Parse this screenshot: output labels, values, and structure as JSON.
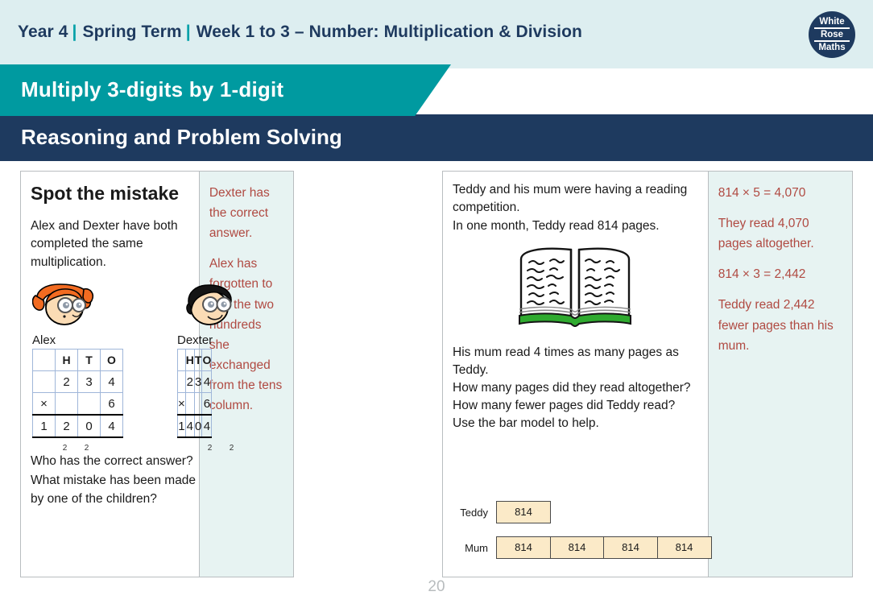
{
  "header": {
    "year": "Year 4",
    "term": "Spring Term",
    "week": "Week 1 to 3 – Number: Multiplication & Division",
    "separator": "|",
    "logo": {
      "line1": "White",
      "line2": "Rose",
      "line3": "Maths"
    }
  },
  "bands": {
    "topic": "Multiply 3-digits by 1-digit",
    "section": "Reasoning and Problem Solving",
    "teal_color": "#009aa0",
    "navy_color": "#1e3a5f",
    "header_bg": "#ddeef0"
  },
  "question1": {
    "title": "Spot the mistake",
    "intro": "Alex and Dexter have both completed the same multiplication.",
    "characters": [
      {
        "name": "Alex",
        "hair_color": "#f26b21",
        "icon": "girl-face-glasses-icon"
      },
      {
        "name": "Dexter",
        "hair_color": "#141414",
        "icon": "boy-face-glasses-icon"
      }
    ],
    "table_headers": [
      "",
      "H",
      "T",
      "O"
    ],
    "alex_calc": {
      "row_number": [
        "",
        "2",
        "3",
        "4"
      ],
      "row_operator": [
        "×",
        "",
        "",
        "6"
      ],
      "row_answer": [
        "1",
        "2",
        "0",
        "4"
      ],
      "carries": [
        "2",
        "2"
      ]
    },
    "dexter_calc": {
      "row_number": [
        "",
        "2",
        "3",
        "4"
      ],
      "row_operator": [
        "×",
        "",
        "",
        "6"
      ],
      "row_answer": [
        "1",
        "4",
        "0",
        "4"
      ],
      "carries": [
        "2",
        "2"
      ]
    },
    "footer_line1": "Who has the correct answer?",
    "footer_line2": "What mistake has been made by one of the children?"
  },
  "answer1": {
    "paragraphs": [
      "Dexter has the correct answer.",
      "Alex has forgotten to add the two hundreds she exchanged from the tens column."
    ],
    "text_color": "#b04a42",
    "bg_color": "#e7f3f2"
  },
  "question2": {
    "intro_line1": "Teddy and his mum were having a reading competition.",
    "intro_line2": "In one month, Teddy read 814 pages.",
    "book_icon": "open-book-icon",
    "body_line1": "His mum read 4 times as many pages as Teddy.",
    "body_line2": "How many pages did they read altogether?",
    "body_line3": "How many fewer pages did Teddy read?",
    "body_line4": "Use the bar model to help.",
    "bar_model": {
      "teddy_label": "Teddy",
      "teddy_segments": [
        "814"
      ],
      "mum_label": "Mum",
      "mum_segments": [
        "814",
        "814",
        "814",
        "814"
      ],
      "segment_fill": "#fbeac8"
    }
  },
  "answer2": {
    "paragraphs": [
      "814 × 5 = 4,070",
      "They read 4,070 pages altogether.",
      "814 × 3 = 2,442",
      "Teddy read 2,442 fewer pages than his mum."
    ],
    "text_color": "#b04a42",
    "bg_color": "#e7f3f2"
  },
  "page_number": "20"
}
